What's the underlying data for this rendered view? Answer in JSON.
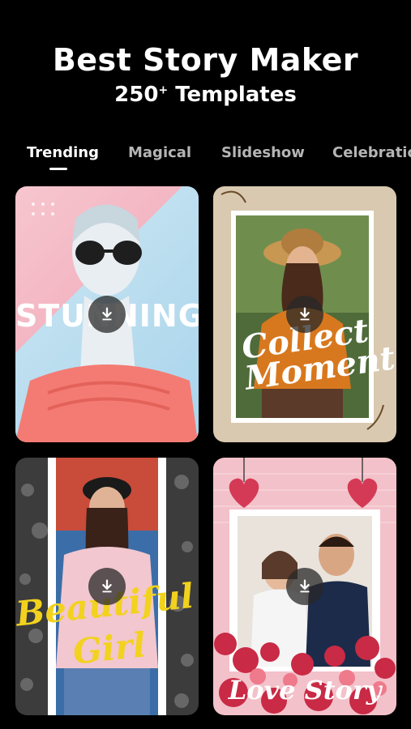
{
  "header": {
    "title": "Best Story Maker",
    "subtitle_count": "250",
    "subtitle_plus": "+",
    "subtitle_rest": " Templates"
  },
  "tabs": [
    "Trending",
    "Magical",
    "Slideshow",
    "Celebration"
  ],
  "cards": [
    {
      "text": "STUNNING"
    },
    {
      "text_line1": "Collect",
      "text_line2": "Moment"
    },
    {
      "text_line1": "Beautiful",
      "text_line2": "Girl"
    },
    {
      "text": "Love Story"
    }
  ],
  "icons": {
    "download": "download-icon"
  },
  "colors": {
    "background": "#000000",
    "text": "#ffffff",
    "inactive_tab": "#b5b5b5",
    "accent_yellow": "#f2d21e"
  }
}
